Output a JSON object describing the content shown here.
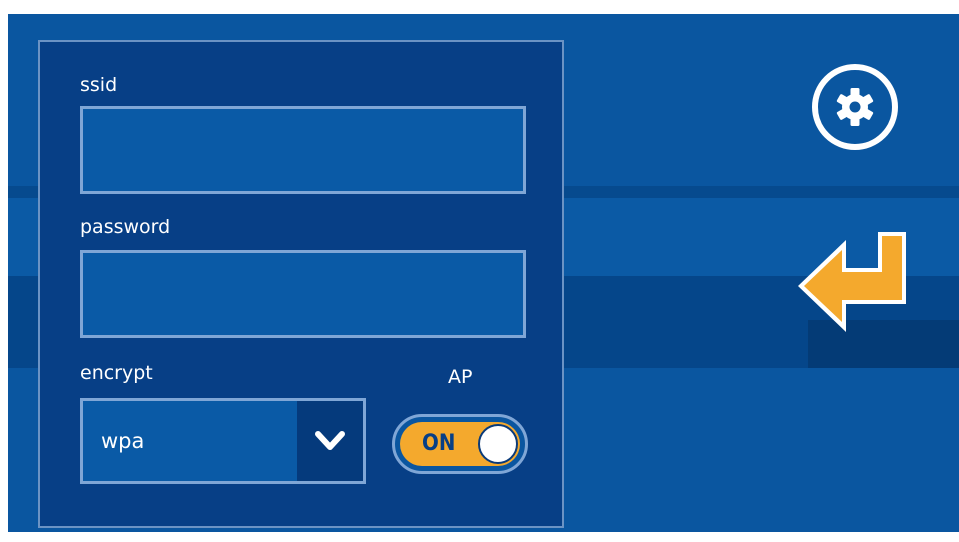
{
  "form": {
    "ssid_label": "ssid",
    "ssid_value": "",
    "password_label": "password",
    "password_value": "",
    "encrypt_label": "encrypt",
    "encrypt_value": "wpa",
    "ap_label": "AP",
    "ap_toggle_text": "ON",
    "ap_enabled": true
  },
  "icons": {
    "settings": "gear-icon",
    "enter": "enter-arrow-icon",
    "dropdown": "chevron-down-icon"
  },
  "colors": {
    "background": "#0a56a0",
    "panel": "#073f86",
    "accent": "#f4a92d",
    "border": "#7fa6d6"
  }
}
